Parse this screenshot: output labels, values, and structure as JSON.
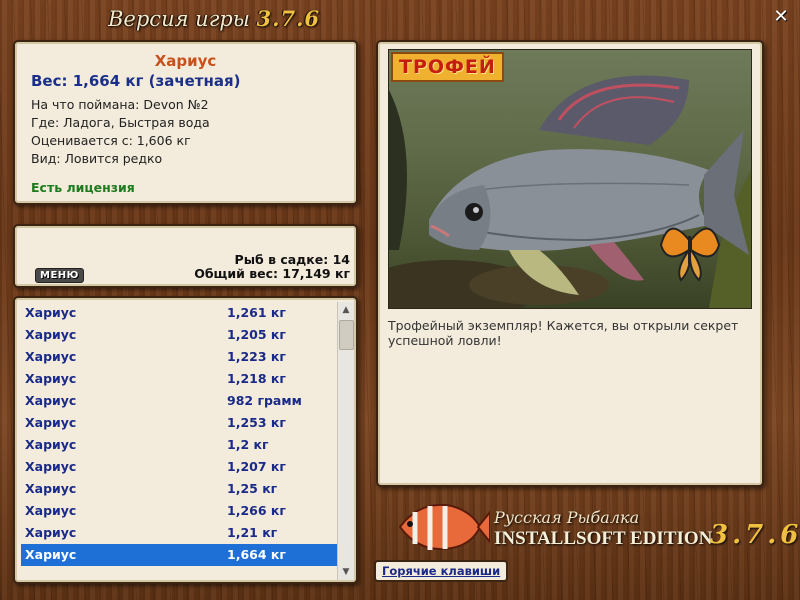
{
  "window": {
    "title": "Версия игры",
    "version": "3.7.6"
  },
  "info": {
    "fish_name": "Хариус",
    "weight": "Вес: 1,664 кг (зачетная)",
    "bait": "На что поймана: Devon №2",
    "place": "Где: Ладога, Быстрая вода",
    "threshold": "Оценивается с: 1,606 кг",
    "kind": "Вид: Ловится редко",
    "license": "Есть лицензия"
  },
  "summary": {
    "menu_label": "МЕНЮ",
    "count": "Рыб в садке: 14",
    "total": "Общий вес: 17,149 кг"
  },
  "catch": {
    "rows": [
      {
        "name": "Хариус",
        "weight": "1,261 кг"
      },
      {
        "name": "Хариус",
        "weight": "1,205 кг"
      },
      {
        "name": "Хариус",
        "weight": "1,223 кг"
      },
      {
        "name": "Хариус",
        "weight": "1,218 кг"
      },
      {
        "name": "Хариус",
        "weight": "982 грамм"
      },
      {
        "name": "Хариус",
        "weight": "1,253 кг"
      },
      {
        "name": "Хариус",
        "weight": "1,2 кг"
      },
      {
        "name": "Хариус",
        "weight": "1,207 кг"
      },
      {
        "name": "Хариус",
        "weight": "1,25 кг"
      },
      {
        "name": "Хариус",
        "weight": "1,266 кг"
      },
      {
        "name": "Хариус",
        "weight": "1,21 кг"
      },
      {
        "name": "Хариус",
        "weight": "1,664 кг"
      }
    ],
    "selected_index": 11
  },
  "trophy": {
    "badge": "ТРОФЕЙ",
    "caption": "Трофейный экземпляр! Кажется, вы открыли секрет успешной ловли!"
  },
  "logo": {
    "game_name": "Русская Рыбалка",
    "edition": "INSTALLSOFT EDITION",
    "version": "3.7.6"
  },
  "hotkeys_label": "Горячие клавиши",
  "colors": {
    "selection": "#1e6fd6",
    "fish_name": "#c8501a",
    "link_blue": "#1a2a88",
    "license_green": "#1e7a1e"
  }
}
